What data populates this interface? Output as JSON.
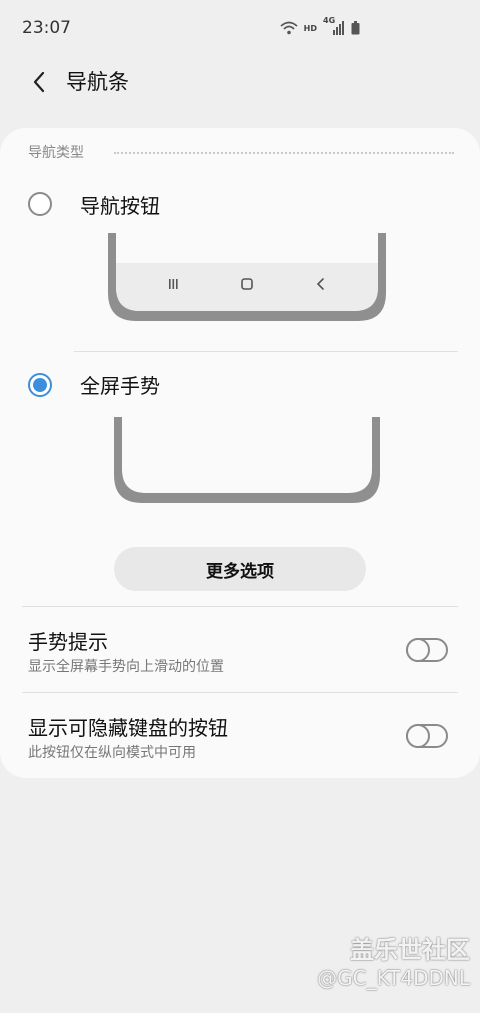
{
  "status_bar": {
    "time": "23:07",
    "hd": "HD",
    "network": "4G"
  },
  "header": {
    "title": "导航条"
  },
  "nav_type": {
    "section_label": "导航类型",
    "options": [
      {
        "label": "导航按钮",
        "selected": false
      },
      {
        "label": "全屏手势",
        "selected": true
      }
    ],
    "more_button": "更多选项"
  },
  "settings": [
    {
      "title": "手势提示",
      "subtitle": "显示全屏幕手势向上滑动的位置",
      "enabled": false
    },
    {
      "title": "显示可隐藏键盘的按钮",
      "subtitle": "此按钮仅在纵向模式中可用",
      "enabled": false
    }
  ],
  "watermark": {
    "title": "盖乐世社区",
    "user": "@GC_KT4DDNL"
  },
  "colors": {
    "accent": "#3c8fdc",
    "background": "#efefef",
    "card": "#fafafa"
  }
}
